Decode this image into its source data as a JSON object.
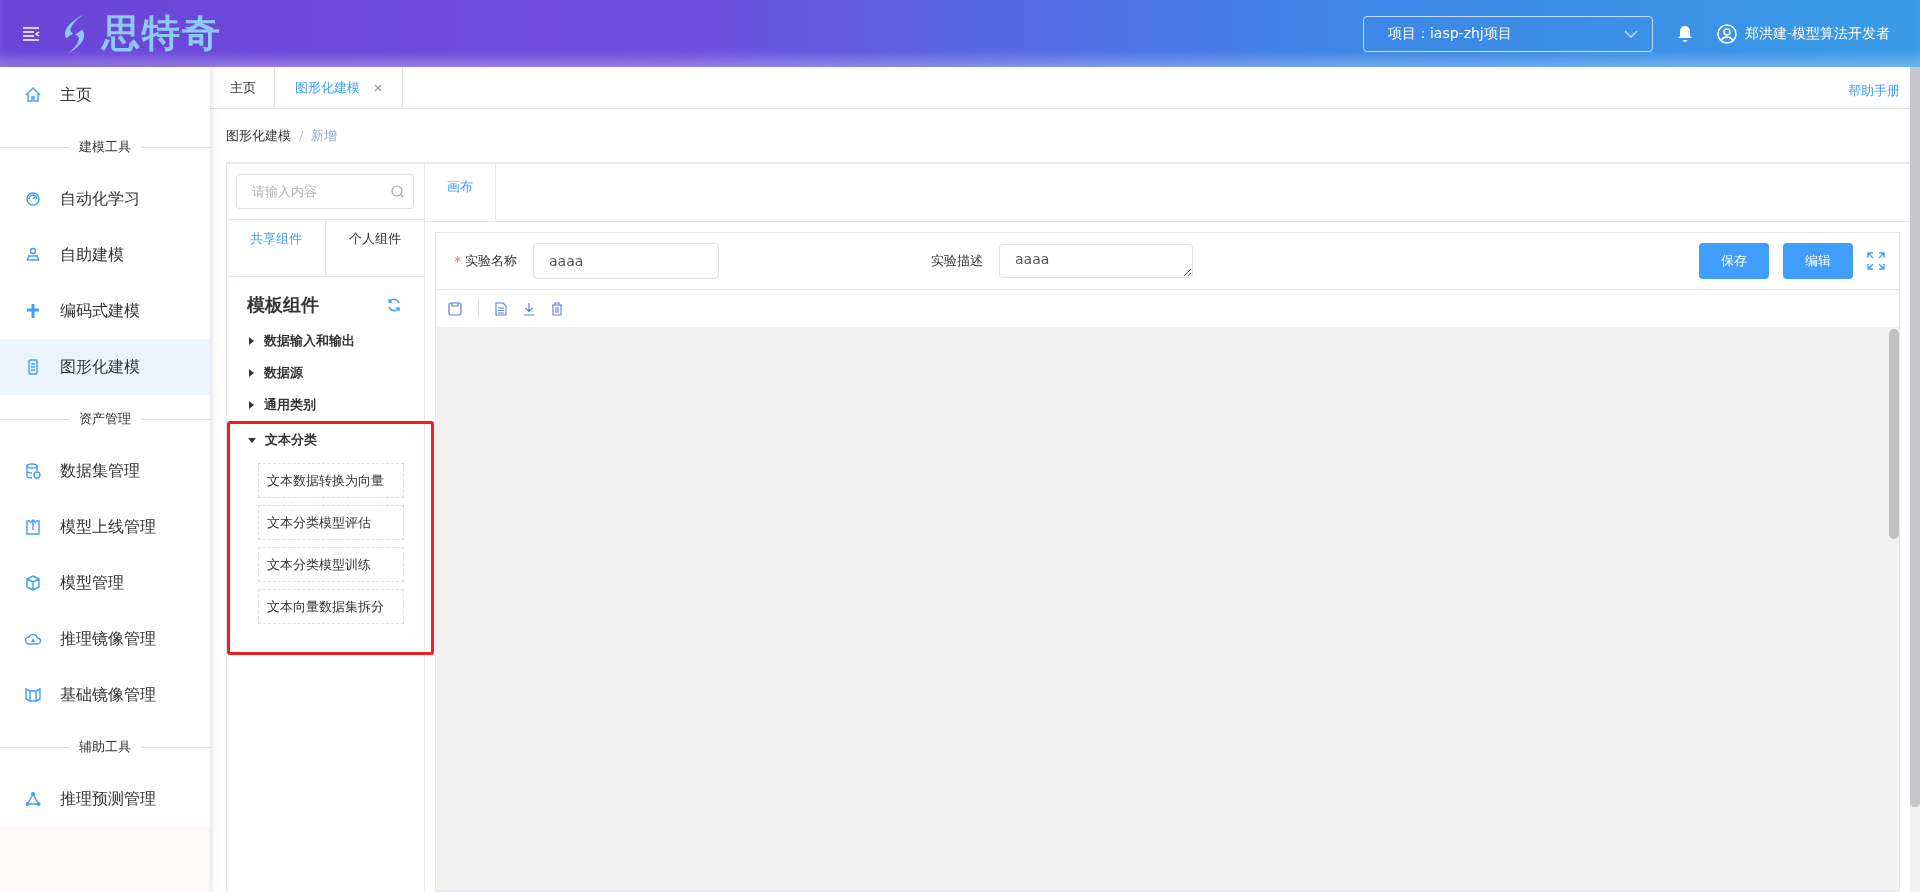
{
  "header": {
    "logo": "思特奇",
    "project": "项目：iasp-zhj项目",
    "user": "郑洪建-模型算法开发者"
  },
  "sidebar": {
    "items": [
      {
        "kind": "item",
        "label": "主页",
        "selected": false
      },
      {
        "kind": "section",
        "label": "建模工具"
      },
      {
        "kind": "item",
        "label": "自动化学习",
        "selected": false
      },
      {
        "kind": "item",
        "label": "自助建模",
        "selected": false
      },
      {
        "kind": "item",
        "label": "编码式建模",
        "selected": false
      },
      {
        "kind": "item",
        "label": "图形化建模",
        "selected": true
      },
      {
        "kind": "section",
        "label": "资产管理"
      },
      {
        "kind": "item",
        "label": "数据集管理",
        "selected": false
      },
      {
        "kind": "item",
        "label": "模型上线管理",
        "selected": false
      },
      {
        "kind": "item",
        "label": "模型管理",
        "selected": false
      },
      {
        "kind": "item",
        "label": "推理镜像管理",
        "selected": false
      },
      {
        "kind": "item",
        "label": "基础镜像管理",
        "selected": false
      },
      {
        "kind": "section",
        "label": "辅助工具"
      },
      {
        "kind": "item",
        "label": "推理预测管理",
        "selected": false
      }
    ]
  },
  "tabs": [
    {
      "label": "主页",
      "selected": false,
      "closable": false
    },
    {
      "label": "图形化建模",
      "selected": true,
      "closable": true
    }
  ],
  "help_link": "帮助手册",
  "breadcrumb": [
    "图形化建模",
    "新增"
  ],
  "breadcrumb_separator": "/",
  "components": {
    "search": {
      "placeholder": "请输入内容"
    },
    "tabs": [
      {
        "label": "共享组件",
        "selected": true
      },
      {
        "label": "个人组件",
        "selected": false
      }
    ],
    "title": "模板组件",
    "tree": [
      {
        "label": "数据输入和输出",
        "expanded": false,
        "highlighted": false
      },
      {
        "label": "数据源",
        "expanded": false,
        "highlighted": false
      },
      {
        "label": "通用类别",
        "expanded": false,
        "highlighted": false
      },
      {
        "label": "文本分类",
        "expanded": true,
        "highlighted": true,
        "children": [
          {
            "label": "文本数据转换为向量"
          },
          {
            "label": "文本分类模型评估"
          },
          {
            "label": "文本分类模型训练"
          },
          {
            "label": "文本向量数据集拆分"
          }
        ]
      }
    ]
  },
  "canvas": {
    "tabs": [
      {
        "label": "画布",
        "selected": true
      }
    ],
    "form": [
      {
        "label": "实验名称",
        "required_mark": "*",
        "value": "aaaa",
        "kind": "input"
      },
      {
        "label": "实验描述",
        "value": "aaaa",
        "kind": "textarea"
      }
    ],
    "buttons": [
      "保存",
      "编辑"
    ]
  }
}
